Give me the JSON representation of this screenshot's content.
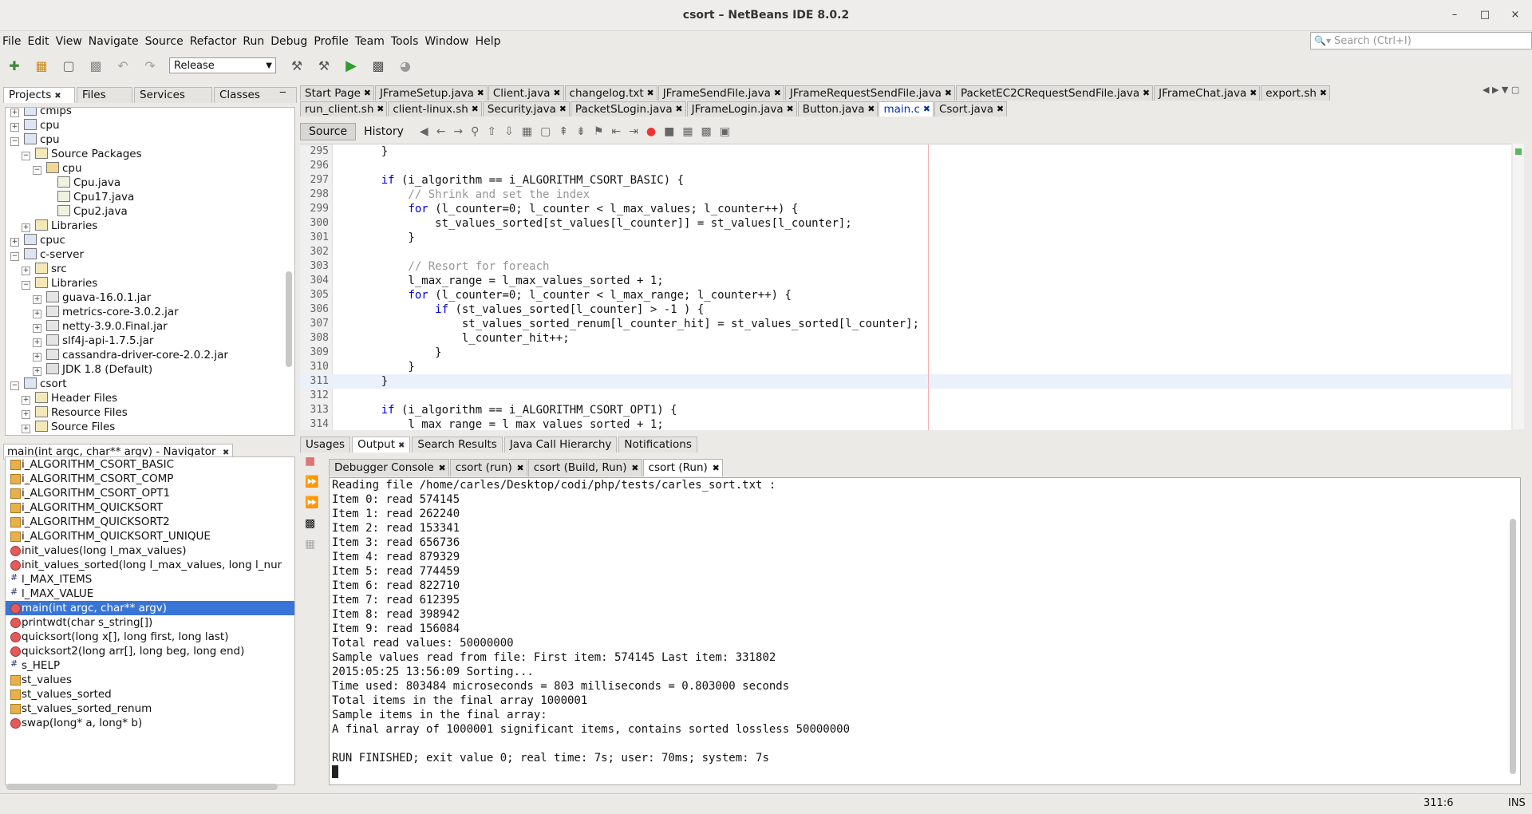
{
  "window": {
    "title": "csort – NetBeans IDE 8.0.2",
    "minimize": "–",
    "maximize": "□",
    "close": "×"
  },
  "menu": [
    "File",
    "Edit",
    "View",
    "Navigate",
    "Source",
    "Refactor",
    "Run",
    "Debug",
    "Profile",
    "Team",
    "Tools",
    "Window",
    "Help"
  ],
  "search": {
    "placeholder": "Search (Ctrl+I)"
  },
  "toolbar": {
    "config": "Release"
  },
  "left_tabs": [
    "Projects",
    "Files",
    "Services",
    "Classes"
  ],
  "project_tree": [
    {
      "label": "cmips",
      "indent": 0,
      "type": "project"
    },
    {
      "label": "cpu",
      "indent": 0,
      "type": "project"
    },
    {
      "label": "cpu",
      "indent": 0,
      "type": "project"
    },
    {
      "label": "Source Packages",
      "indent": 1,
      "type": "folder"
    },
    {
      "label": "cpu",
      "indent": 2,
      "type": "package"
    },
    {
      "label": "Cpu.java",
      "indent": 3,
      "type": "file"
    },
    {
      "label": "Cpu17.java",
      "indent": 3,
      "type": "file"
    },
    {
      "label": "Cpu2.java",
      "indent": 3,
      "type": "file"
    },
    {
      "label": "Libraries",
      "indent": 1,
      "type": "folder"
    },
    {
      "label": "cpuc",
      "indent": 0,
      "type": "project"
    },
    {
      "label": "c-server",
      "indent": 0,
      "type": "project"
    },
    {
      "label": "src",
      "indent": 1,
      "type": "folder"
    },
    {
      "label": "Libraries",
      "indent": 1,
      "type": "folder"
    },
    {
      "label": "guava-16.0.1.jar",
      "indent": 2,
      "type": "jar"
    },
    {
      "label": "metrics-core-3.0.2.jar",
      "indent": 2,
      "type": "jar"
    },
    {
      "label": "netty-3.9.0.Final.jar",
      "indent": 2,
      "type": "jar"
    },
    {
      "label": "slf4j-api-1.7.5.jar",
      "indent": 2,
      "type": "jar"
    },
    {
      "label": "cassandra-driver-core-2.0.2.jar",
      "indent": 2,
      "type": "jar"
    },
    {
      "label": "JDK 1.8 (Default)",
      "indent": 2,
      "type": "jdk"
    },
    {
      "label": "csort",
      "indent": 0,
      "type": "project"
    },
    {
      "label": "Header Files",
      "indent": 1,
      "type": "folder"
    },
    {
      "label": "Resource Files",
      "indent": 1,
      "type": "folder"
    },
    {
      "label": "Source Files",
      "indent": 1,
      "type": "folder"
    }
  ],
  "navigator": {
    "title": "main(int argc, char** argv) - Navigator",
    "items": [
      {
        "label": "i_ALGORITHM_CSORT_BASIC",
        "kind": "var"
      },
      {
        "label": "i_ALGORITHM_CSORT_COMP",
        "kind": "var"
      },
      {
        "label": "i_ALGORITHM_CSORT_OPT1",
        "kind": "var"
      },
      {
        "label": "i_ALGORITHM_QUICKSORT",
        "kind": "var"
      },
      {
        "label": "i_ALGORITHM_QUICKSORT2",
        "kind": "var"
      },
      {
        "label": "i_ALGORITHM_QUICKSORT_UNIQUE",
        "kind": "var"
      },
      {
        "label": "init_values(long l_max_values)",
        "kind": "func"
      },
      {
        "label": "init_values_sorted(long l_max_values, long l_nur",
        "kind": "func"
      },
      {
        "label": "l_MAX_ITEMS",
        "kind": "macro"
      },
      {
        "label": "l_MAX_VALUE",
        "kind": "macro"
      },
      {
        "label": "main(int argc, char** argv)",
        "kind": "func",
        "selected": true
      },
      {
        "label": "printwdt(char s_string[])",
        "kind": "func"
      },
      {
        "label": "quicksort(long x[], long first, long last)",
        "kind": "func"
      },
      {
        "label": "quicksort2(long arr[], long beg, long end)",
        "kind": "func"
      },
      {
        "label": "s_HELP",
        "kind": "macro"
      },
      {
        "label": "st_values",
        "kind": "var"
      },
      {
        "label": "st_values_sorted",
        "kind": "var"
      },
      {
        "label": "st_values_sorted_renum",
        "kind": "var"
      },
      {
        "label": "swap(long* a, long* b)",
        "kind": "func"
      }
    ]
  },
  "editor_tabs_row1": [
    "Start Page",
    "JFrameSetup.java",
    "Client.java",
    "changelog.txt",
    "JFrameSendFile.java",
    "JFrameRequestSendFile.java",
    "PacketEC2CRequestSendFile.java",
    "JFrameChat.java",
    "export.sh"
  ],
  "editor_tabs_row2": [
    "run_client.sh",
    "client-linux.sh",
    "Security.java",
    "PacketSLogin.java",
    "JFrameLogin.java",
    "Button.java",
    "main.c",
    "Csort.java"
  ],
  "editor_view_tabs": [
    "Source",
    "History"
  ],
  "code": [
    {
      "n": "295",
      "t": "    }"
    },
    {
      "n": "296",
      "t": ""
    },
    {
      "n": "297",
      "t": "    if (i_algorithm == i_ALGORITHM_CSORT_BASIC) {"
    },
    {
      "n": "298",
      "t": "        // Shrink and set the index"
    },
    {
      "n": "299",
      "t": "        for (l_counter=0; l_counter < l_max_values; l_counter++) {"
    },
    {
      "n": "300",
      "t": "            st_values_sorted[st_values[l_counter]] = st_values[l_counter];"
    },
    {
      "n": "301",
      "t": "        }"
    },
    {
      "n": "302",
      "t": ""
    },
    {
      "n": "303",
      "t": "        // Resort for foreach"
    },
    {
      "n": "304",
      "t": "        l_max_range = l_max_values_sorted + 1;"
    },
    {
      "n": "305",
      "t": "        for (l_counter=0; l_counter < l_max_range; l_counter++) {"
    },
    {
      "n": "306",
      "t": "            if (st_values_sorted[l_counter] > -1 ) {"
    },
    {
      "n": "307",
      "t": "                st_values_sorted_renum[l_counter_hit] = st_values_sorted[l_counter];"
    },
    {
      "n": "308",
      "t": "                l_counter_hit++;"
    },
    {
      "n": "309",
      "t": "            }"
    },
    {
      "n": "310",
      "t": "        }"
    },
    {
      "n": "311",
      "t": "    }"
    },
    {
      "n": "312",
      "t": ""
    },
    {
      "n": "313",
      "t": "    if (i_algorithm == i_ALGORITHM_CSORT_OPT1) {"
    },
    {
      "n": "314",
      "t": "        l_max_range = l_max_values_sorted + 1;"
    }
  ],
  "bottom_tabs": [
    "Usages",
    "Output",
    "Search Results",
    "Java Call Hierarchy",
    "Notifications"
  ],
  "output_tabs": [
    "Debugger Console",
    "csort (run)",
    "csort (Build, Run)",
    "csort (Run)"
  ],
  "output_lines": [
    "Reading file /home/carles/Desktop/codi/php/tests/carles_sort.txt :",
    "Item 0: read 574145",
    "Item 1: read 262240",
    "Item 2: read 153341",
    "Item 3: read 656736",
    "Item 4: read 879329",
    "Item 5: read 774459",
    "Item 6: read 822710",
    "Item 7: read 612395",
    "Item 8: read 398942",
    "Item 9: read 156084",
    "Total read values: 50000000",
    "Sample values read from file: First item: 574145 Last item: 331802",
    "2015:05:25 13:56:09 Sorting...",
    "Time used: 803484 microseconds = 803 milliseconds = 0.803000 seconds",
    "Total items in the final array 1000001",
    "Sample items in the final array:",
    "A final array of 1000001 significant items, contains sorted lossless 50000000",
    "",
    "RUN FINISHED; exit value 0; real time: 7s; user: 70ms; system: 7s"
  ],
  "status": {
    "position": "311:6",
    "mode": "INS"
  }
}
